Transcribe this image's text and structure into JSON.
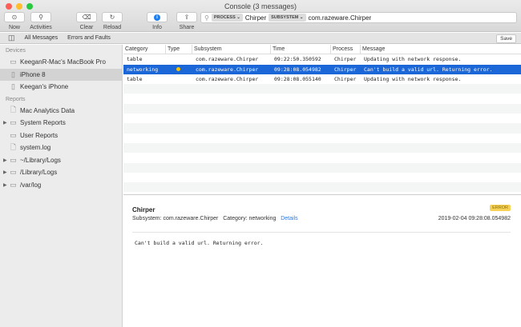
{
  "window": {
    "title": "Console (3 messages)"
  },
  "toolbar": {
    "now": "Now",
    "activities": "Activities",
    "clear": "Clear",
    "reload": "Reload",
    "info": "Info",
    "share": "Share"
  },
  "search": {
    "process_token": "PROCESS ⌄",
    "process_value": "Chirper",
    "subsystem_token": "SUBSYSTEM ⌄",
    "subsystem_value": "com.razeware.Chirper"
  },
  "filterbar": {
    "all": "All Messages",
    "errors": "Errors and Faults",
    "save": "Save"
  },
  "sidebar": {
    "devices_header": "Devices",
    "devices": [
      {
        "label": "KeeganR-Mac's MacBook Pro",
        "icon": "laptop-icon"
      },
      {
        "label": "iPhone 8",
        "icon": "iphone-icon",
        "selected": true
      },
      {
        "label": "Keegan's iPhone",
        "icon": "iphone-icon"
      }
    ],
    "reports_header": "Reports",
    "reports": [
      {
        "label": "Mac Analytics Data",
        "icon": "document-icon"
      },
      {
        "label": "System Reports",
        "icon": "folder-icon",
        "expandable": true
      },
      {
        "label": "User Reports",
        "icon": "folder-icon"
      },
      {
        "label": "system.log",
        "icon": "document-icon"
      },
      {
        "label": "~/Library/Logs",
        "icon": "folder-icon",
        "expandable": true
      },
      {
        "label": "/Library/Logs",
        "icon": "folder-icon",
        "expandable": true
      },
      {
        "label": "/var/log",
        "icon": "folder-icon",
        "expandable": true
      }
    ]
  },
  "table": {
    "columns": [
      "Category",
      "Type",
      "Subsystem",
      "Time",
      "Process",
      "Message"
    ],
    "rows": [
      {
        "category": "table",
        "type": "",
        "subsystem": "com.razeware.Chirper",
        "time": "09:22:50.350592",
        "process": "Chirper",
        "message": "Updating with network response."
      },
      {
        "category": "networking",
        "type": "error",
        "subsystem": "com.razeware.Chirper",
        "time": "09:28:08.054982",
        "process": "Chirper",
        "message": "Can't build a valid url. Returning error.",
        "selected": true
      },
      {
        "category": "table",
        "type": "",
        "subsystem": "com.razeware.Chirper",
        "time": "09:28:08.055140",
        "process": "Chirper",
        "message": "Updating with network response."
      }
    ]
  },
  "detail": {
    "process": "Chirper",
    "subsystem": "Subsystem: com.razeware.Chirper",
    "category": "Category: networking",
    "details_link": "Details",
    "badge": "ERROR",
    "timestamp": "2019-02-04 09:28:08.054982",
    "message": "Can't build a valid url. Returning error."
  },
  "colors": {
    "selection": "#1b67d8",
    "error_dot": "#f5c400",
    "badge": "#f7d257",
    "link": "#2d7be0"
  }
}
